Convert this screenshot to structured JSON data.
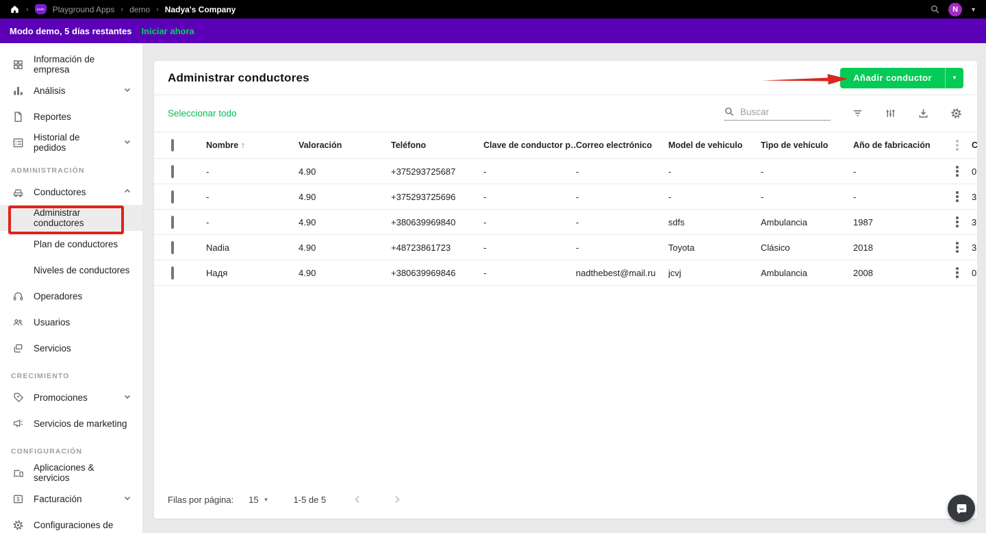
{
  "topbar": {
    "logo_text": "onde",
    "breadcrumbs": [
      "Playground Apps",
      "demo",
      "Nadya's Company"
    ],
    "avatar_initial": "N"
  },
  "banner": {
    "text": "Modo demo, 5 días restantes",
    "action": "Iniciar ahora"
  },
  "sidebar": {
    "items": [
      {
        "label": "Información de empresa"
      },
      {
        "label": "Análisis"
      },
      {
        "label": "Reportes"
      },
      {
        "label": "Historial de pedidos"
      },
      {
        "label": "ADMINISTRACIÓN"
      },
      {
        "label": "Conductores"
      },
      {
        "label": "Administrar conductores"
      },
      {
        "label": "Plan de conductores"
      },
      {
        "label": "Niveles de conductores"
      },
      {
        "label": "Operadores"
      },
      {
        "label": "Usuarios"
      },
      {
        "label": "Servicios"
      },
      {
        "label": "CRECIMIENTO"
      },
      {
        "label": "Promociones"
      },
      {
        "label": "Servicios de marketing"
      },
      {
        "label": "CONFIGURACIÓN"
      },
      {
        "label": "Aplicaciones & servicios"
      },
      {
        "label": "Facturación"
      },
      {
        "label": "Configuraciones de"
      }
    ]
  },
  "main": {
    "title": "Administrar conductores",
    "add_button": "Añadir conductor",
    "select_all": "Seleccionar todo",
    "search_placeholder": "Buscar",
    "table": {
      "columns": [
        "Nombre",
        "Valoración",
        "Teléfono",
        "Clave de conductor p…",
        "Correo electrónico",
        "Model de vehiculo",
        "Tipo de vehículo",
        "Año de fabricación"
      ],
      "column_clipped": "C",
      "rows": [
        {
          "nombre": "-",
          "valoracion": "4.90",
          "telefono": "+375293725687",
          "clave": "-",
          "correo": "-",
          "model": "-",
          "tipo": "-",
          "ano": "-",
          "clip": "0"
        },
        {
          "nombre": "-",
          "valoracion": "4.90",
          "telefono": "+375293725696",
          "clave": "-",
          "correo": "-",
          "model": "-",
          "tipo": "-",
          "ano": "-",
          "clip": "3"
        },
        {
          "nombre": "-",
          "valoracion": "4.90",
          "telefono": "+380639969840",
          "clave": "-",
          "correo": "-",
          "model": "sdfs",
          "tipo": "Ambulancia",
          "ano": "1987",
          "clip": "3"
        },
        {
          "nombre": "Nadia",
          "valoracion": "4.90",
          "telefono": "+48723861723",
          "clave": "-",
          "correo": "-",
          "model": "Toyota",
          "tipo": "Clásico",
          "ano": "2018",
          "clip": "3"
        },
        {
          "nombre": "Надя",
          "valoracion": "4.90",
          "telefono": "+380639969846",
          "clave": "-",
          "correo": "nadthebest@mail.ru",
          "model": "jcvj",
          "tipo": "Ambulancia",
          "ano": "2008",
          "clip": "0"
        }
      ]
    },
    "pagination": {
      "rows_per_page_label": "Filas por página:",
      "rows_per_page": "15",
      "range": "1-5 de 5"
    }
  },
  "colors": {
    "accent_green": "#04ca56",
    "banner_purple": "#5b00b7",
    "avatar_purple": "#a32cc4",
    "annotation_red": "#df231b",
    "topbar_black": "#000000"
  }
}
